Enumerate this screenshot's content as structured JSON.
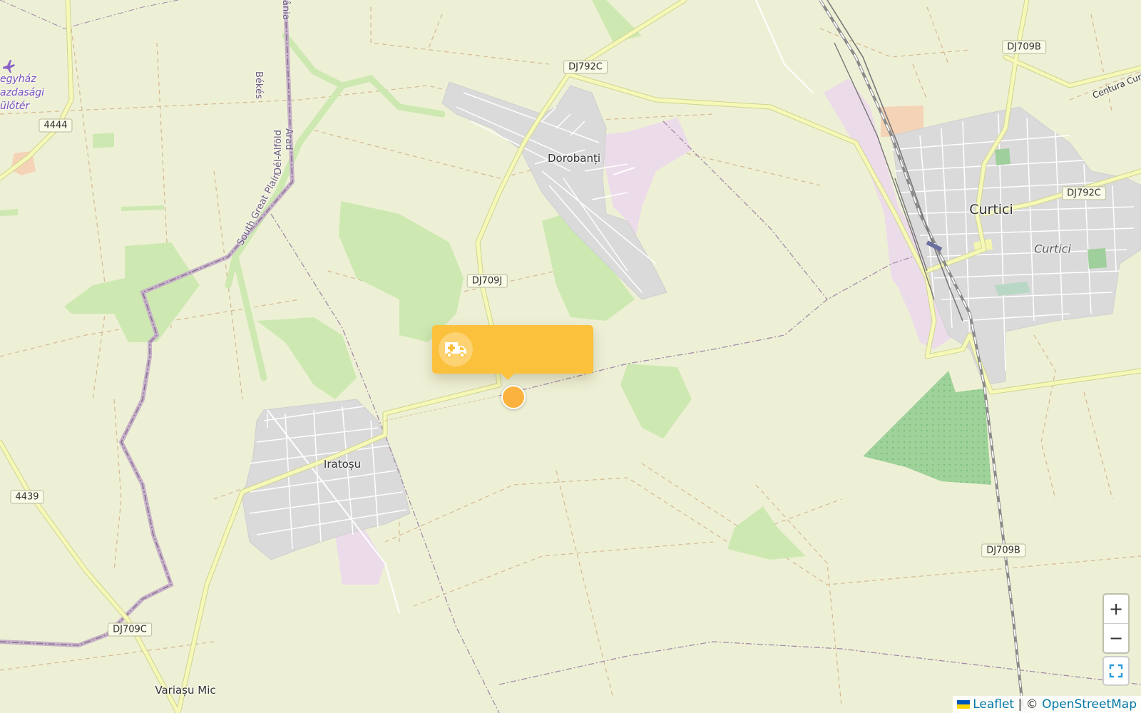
{
  "places": [
    {
      "name": "Dorobanți",
      "kind": "mid"
    },
    {
      "name": "Curtici",
      "kind": "big"
    },
    {
      "name": "Curtici",
      "kind": "italic"
    },
    {
      "name": "Iratoșu",
      "kind": "mid"
    },
    {
      "name": "Variașu Mic",
      "kind": "mid"
    }
  ],
  "poi": {
    "lines": [
      "egyház",
      "azdasági",
      "ülőtér"
    ],
    "icon": "airport-icon"
  },
  "road_shields": [
    "DJ792C",
    "DJ709B",
    "4444",
    "DJ709J",
    "DJ792C",
    "4439",
    "DJ709C",
    "DJ709B"
  ],
  "road_labels": [
    "Békés",
    "Dél-Alföld",
    "Arad",
    "South Great Plain",
    "Centura Curtici",
    "ânia"
  ],
  "popup": {
    "icon": "ambulance-icon",
    "text": "",
    "color": "#fbc13c"
  },
  "marker": {
    "color": "#fbb23e"
  },
  "controls": {
    "zoom_in": "+",
    "zoom_out": "−",
    "fullscreen_icon": "fullscreen-icon"
  },
  "attribution": {
    "leaflet": "Leaflet",
    "separator": " | © ",
    "osm": "OpenStreetMap"
  },
  "colors": {
    "background": "#eef0d6",
    "residential": "#dadada",
    "forest": "#cde9b1",
    "secondary_road": "#f6f8b8",
    "boundary": "#a88dad",
    "rail": "#777777"
  }
}
